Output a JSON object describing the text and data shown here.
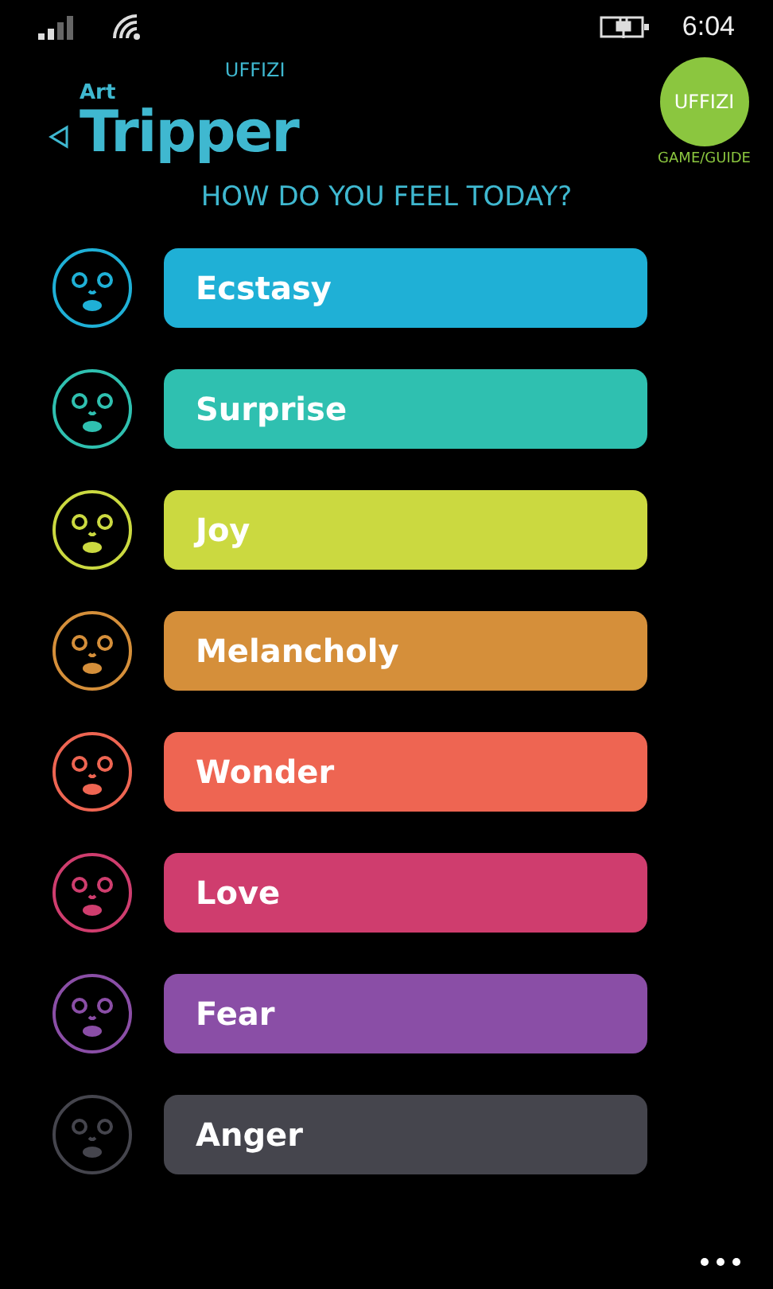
{
  "status_bar": {
    "time": "6:04"
  },
  "logo": {
    "small": "Art",
    "main": "Tripper",
    "sub": "UFFIZI"
  },
  "badge": {
    "label": "UFFIZI",
    "caption": "GAME/GUIDE"
  },
  "title": "HOW DO YOU FEEL TODAY?",
  "moods": [
    {
      "label": "Ecstasy",
      "color": "#1fb0d6"
    },
    {
      "label": "Surprise",
      "color": "#2fc0b0"
    },
    {
      "label": "Joy",
      "color": "#cbd940"
    },
    {
      "label": "Melancholy",
      "color": "#d58f3a"
    },
    {
      "label": "Wonder",
      "color": "#ee6552"
    },
    {
      "label": "Love",
      "color": "#cf3d6e"
    },
    {
      "label": "Fear",
      "color": "#8a4ea6"
    },
    {
      "label": "Anger",
      "color": "#45454d"
    }
  ]
}
